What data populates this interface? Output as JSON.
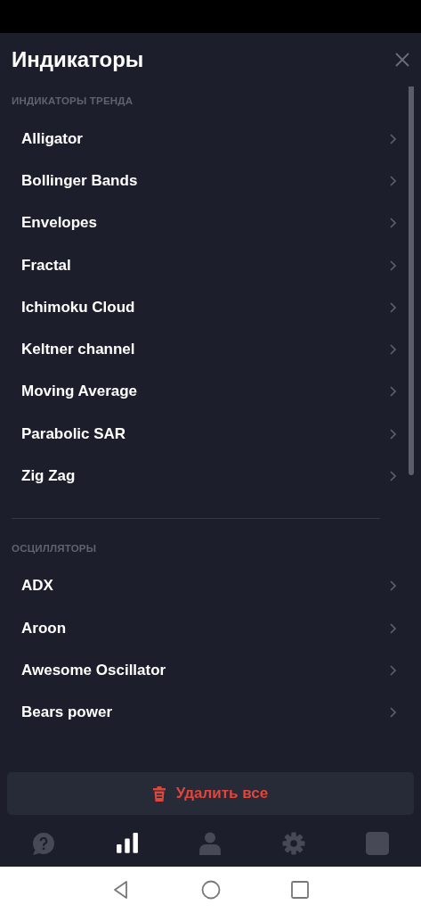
{
  "header": {
    "title": "Индикаторы"
  },
  "sections": [
    {
      "title": "ИНДИКАТОРЫ ТРЕНДА",
      "items": [
        {
          "label": "Alligator"
        },
        {
          "label": "Bollinger Bands"
        },
        {
          "label": "Envelopes"
        },
        {
          "label": "Fractal"
        },
        {
          "label": "Ichimoku Cloud"
        },
        {
          "label": "Keltner channel"
        },
        {
          "label": "Moving Average"
        },
        {
          "label": "Parabolic SAR"
        },
        {
          "label": "Zig Zag"
        }
      ]
    },
    {
      "title": "ОСЦИЛЛЯТОРЫ",
      "items": [
        {
          "label": "ADX"
        },
        {
          "label": "Aroon"
        },
        {
          "label": "Awesome Oscillator"
        },
        {
          "label": "Bears power"
        }
      ]
    }
  ],
  "delete_button": {
    "label": "Удалить все"
  },
  "tab_bar": [
    {
      "kind": "help",
      "selected": false
    },
    {
      "kind": "chart",
      "selected": true
    },
    {
      "kind": "profile",
      "selected": false
    },
    {
      "kind": "settings",
      "selected": false
    },
    {
      "kind": "square",
      "selected": false
    }
  ],
  "nav_bar": [
    {
      "kind": "back"
    },
    {
      "kind": "home"
    },
    {
      "kind": "recents"
    }
  ]
}
